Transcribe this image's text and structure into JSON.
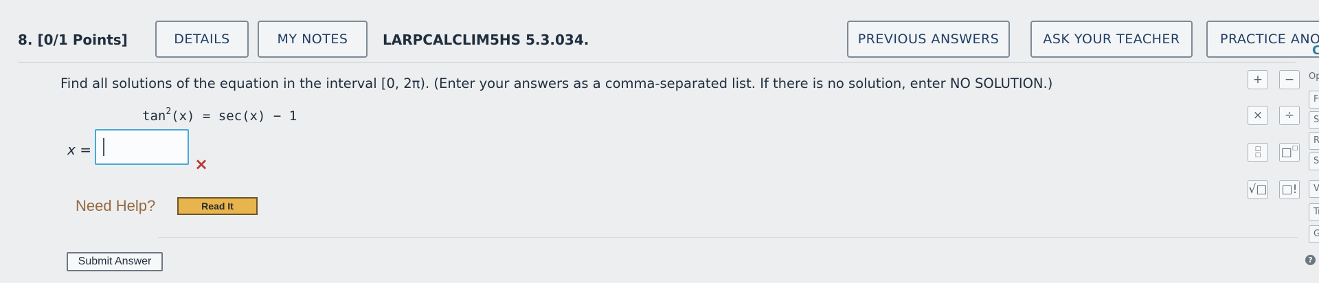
{
  "question": {
    "number": "8.",
    "points": "[0/1 Points]",
    "reference": "LARPCALCLIM5HS 5.3.034."
  },
  "header": {
    "details": "DETAILS",
    "my_notes": "MY NOTES",
    "previous_answers": "PREVIOUS ANSWERS",
    "ask_teacher": "ASK YOUR TEACHER",
    "practice_another": "PRACTICE ANOTHER"
  },
  "body": {
    "prompt": "Find all solutions of the equation in the interval [0, 2π). (Enter your answers as a comma-separated list. If there is no solution, enter NO SOLUTION.)",
    "equation_lhs": "tan",
    "equation_exp": "2",
    "equation_rhs": "(x) = sec(x) − 1",
    "answer_label": "x =",
    "answer_value": "",
    "wrong_mark": "×"
  },
  "help": {
    "need_help": "Need Help?",
    "read_it": "Read It"
  },
  "submit_label": "Submit Answer",
  "palette": {
    "plus": "+",
    "minus": "−",
    "times": "×",
    "divide": "÷",
    "fraction_top": "□",
    "fraction_bottom": "□",
    "power": "□",
    "power_exp": "□",
    "sqrt": "√□",
    "factorial": "□!"
  },
  "side_panel": {
    "title": "Ca",
    "items": [
      "Op",
      "Fu",
      "Sy",
      "Re",
      "Se",
      "Ve",
      "Trig",
      "Gre"
    ]
  },
  "colors": {
    "accent_blue": "#47a8d6",
    "wrong_red": "#b83a3a",
    "read_it_bg": "#e8b44d",
    "header_text": "#1f3d66"
  }
}
